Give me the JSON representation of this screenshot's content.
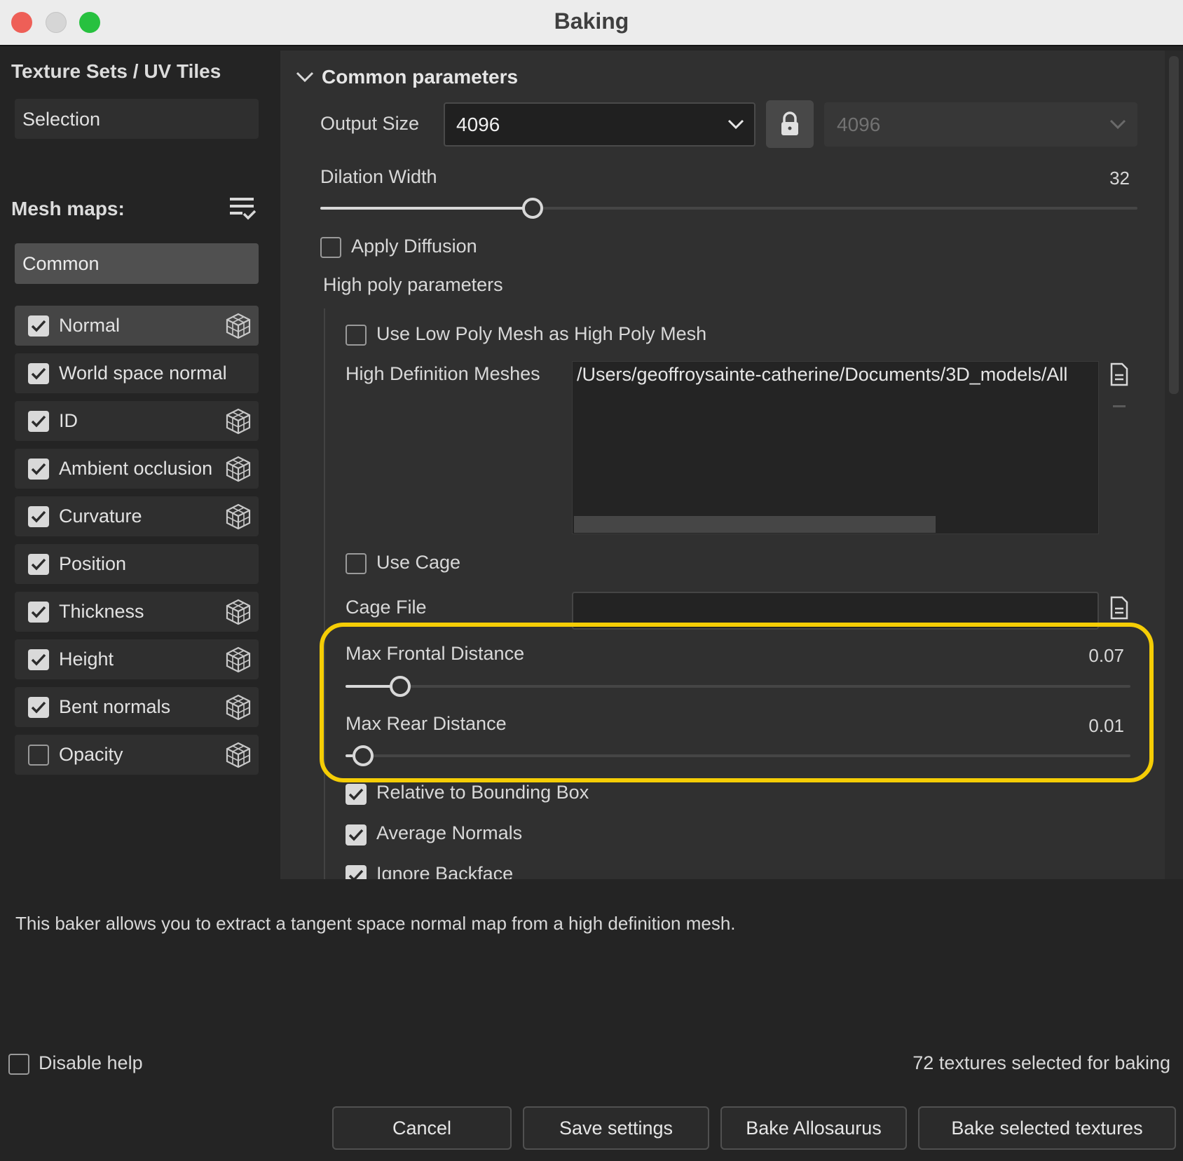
{
  "window": {
    "title": "Baking"
  },
  "left": {
    "texture_sets_title": "Texture Sets / UV Tiles",
    "selection_label": "Selection",
    "mesh_maps_title": "Mesh maps:",
    "common_label": "Common",
    "maps": [
      {
        "label": "Normal",
        "checked": true,
        "cube": true,
        "active": true
      },
      {
        "label": "World space normal",
        "checked": true,
        "cube": false
      },
      {
        "label": "ID",
        "checked": true,
        "cube": true
      },
      {
        "label": "Ambient occlusion",
        "checked": true,
        "cube": true
      },
      {
        "label": "Curvature",
        "checked": true,
        "cube": true
      },
      {
        "label": "Position",
        "checked": true,
        "cube": false
      },
      {
        "label": "Thickness",
        "checked": true,
        "cube": true
      },
      {
        "label": "Height",
        "checked": true,
        "cube": true
      },
      {
        "label": "Bent normals",
        "checked": true,
        "cube": true
      },
      {
        "label": "Opacity",
        "checked": false,
        "cube": true
      }
    ]
  },
  "main": {
    "section_title": "Common parameters",
    "output_size": {
      "label": "Output Size",
      "value": "4096",
      "linked_value": "4096"
    },
    "dilation_width": {
      "label": "Dilation Width",
      "value": "32",
      "fraction": 0.26
    },
    "apply_diffusion": {
      "label": "Apply Diffusion",
      "checked": false
    },
    "high_poly_title": "High poly parameters",
    "use_low_poly": {
      "label": "Use Low Poly Mesh as High Poly Mesh",
      "checked": false
    },
    "high_def_meshes": {
      "label": "High Definition Meshes",
      "path": "/Users/geoffroysainte-catherine/Documents/3D_models/All"
    },
    "use_cage": {
      "label": "Use Cage",
      "checked": false
    },
    "cage_file": {
      "label": "Cage File",
      "value": ""
    },
    "max_frontal": {
      "label": "Max Frontal Distance",
      "value": "0.07",
      "fraction": 0.07
    },
    "max_rear": {
      "label": "Max Rear Distance",
      "value": "0.01",
      "fraction": 0.01
    },
    "relative_bbox": {
      "label": "Relative to Bounding Box",
      "checked": true
    },
    "average_normals": {
      "label": "Average Normals",
      "checked": true
    },
    "ignore_backface": {
      "label": "Ignore Backface",
      "checked": true
    },
    "highlight_color": "#f5cd05"
  },
  "footer": {
    "help_text": "This baker allows you to extract a tangent space normal map from a high definition mesh.",
    "disable_help": "Disable help",
    "status": "72 textures selected for baking",
    "buttons": {
      "cancel": "Cancel",
      "save": "Save settings",
      "bake_allosaurus": "Bake Allosaurus",
      "bake_selected": "Bake selected textures"
    }
  }
}
